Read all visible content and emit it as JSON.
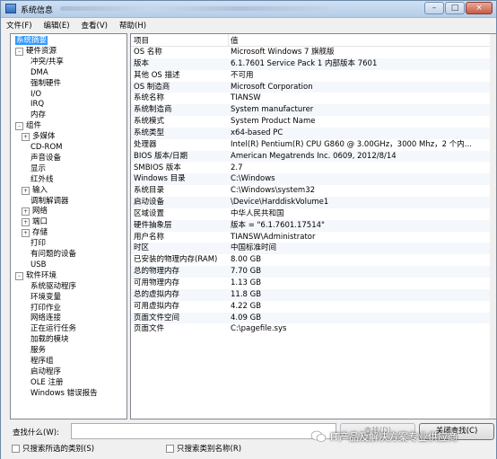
{
  "window": {
    "title": "系统信息",
    "path_hint": "",
    "buttons": {
      "minimize": "–",
      "maximize": "□",
      "close": "×"
    }
  },
  "menu": [
    "文件(F)",
    "编辑(E)",
    "查看(V)",
    "帮助(H)"
  ],
  "tree": [
    {
      "label": "系统摘要",
      "level": 0,
      "toggle": "",
      "selected": true
    },
    {
      "label": "硬件资源",
      "level": 0,
      "toggle": "–"
    },
    {
      "label": "冲突/共享",
      "level": 2,
      "toggle": ""
    },
    {
      "label": "DMA",
      "level": 2,
      "toggle": ""
    },
    {
      "label": "强制硬件",
      "level": 2,
      "toggle": ""
    },
    {
      "label": "I/O",
      "level": 2,
      "toggle": ""
    },
    {
      "label": "IRQ",
      "level": 2,
      "toggle": ""
    },
    {
      "label": "内存",
      "level": 2,
      "toggle": ""
    },
    {
      "label": "组件",
      "level": 0,
      "toggle": "–"
    },
    {
      "label": "多媒体",
      "level": 1,
      "toggle": "+"
    },
    {
      "label": "CD-ROM",
      "level": 2,
      "toggle": ""
    },
    {
      "label": "声音设备",
      "level": 2,
      "toggle": ""
    },
    {
      "label": "显示",
      "level": 2,
      "toggle": ""
    },
    {
      "label": "红外线",
      "level": 2,
      "toggle": ""
    },
    {
      "label": "输入",
      "level": 1,
      "toggle": "+"
    },
    {
      "label": "调制解调器",
      "level": 2,
      "toggle": ""
    },
    {
      "label": "网络",
      "level": 1,
      "toggle": "+"
    },
    {
      "label": "端口",
      "level": 1,
      "toggle": "+"
    },
    {
      "label": "存储",
      "level": 1,
      "toggle": "+"
    },
    {
      "label": "打印",
      "level": 2,
      "toggle": ""
    },
    {
      "label": "有问题的设备",
      "level": 2,
      "toggle": ""
    },
    {
      "label": "USB",
      "level": 2,
      "toggle": ""
    },
    {
      "label": "软件环境",
      "level": 0,
      "toggle": "–"
    },
    {
      "label": "系统驱动程序",
      "level": 2,
      "toggle": ""
    },
    {
      "label": "环境变量",
      "level": 2,
      "toggle": ""
    },
    {
      "label": "打印作业",
      "level": 2,
      "toggle": ""
    },
    {
      "label": "网络连接",
      "level": 2,
      "toggle": ""
    },
    {
      "label": "正在运行任务",
      "level": 2,
      "toggle": ""
    },
    {
      "label": "加载的模块",
      "level": 2,
      "toggle": ""
    },
    {
      "label": "服务",
      "level": 2,
      "toggle": ""
    },
    {
      "label": "程序组",
      "level": 2,
      "toggle": ""
    },
    {
      "label": "启动程序",
      "level": 2,
      "toggle": ""
    },
    {
      "label": "OLE 注册",
      "level": 2,
      "toggle": ""
    },
    {
      "label": "Windows 错误报告",
      "level": 2,
      "toggle": ""
    }
  ],
  "table": {
    "headers": {
      "item": "项目",
      "value": "值"
    },
    "rows": [
      {
        "item": "OS 名称",
        "value": "Microsoft Windows 7 旗舰版"
      },
      {
        "item": "版本",
        "value": "6.1.7601 Service Pack 1 内部版本 7601"
      },
      {
        "item": "其他 OS 描述",
        "value": "不可用"
      },
      {
        "item": "OS 制造商",
        "value": "Microsoft Corporation"
      },
      {
        "item": "系统名称",
        "value": "TIANSW"
      },
      {
        "item": "系统制造商",
        "value": "System manufacturer"
      },
      {
        "item": "系统模式",
        "value": "System Product Name"
      },
      {
        "item": "系统类型",
        "value": "x64-based PC"
      },
      {
        "item": "处理器",
        "value": "Intel(R) Pentium(R) CPU G860 @ 3.00GHz，3000 Mhz，2 个内..."
      },
      {
        "item": "BIOS 版本/日期",
        "value": "American Megatrends Inc. 0609, 2012/8/14"
      },
      {
        "item": "SMBIOS 版本",
        "value": "2.7"
      },
      {
        "item": "Windows 目录",
        "value": "C:\\Windows"
      },
      {
        "item": "系统目录",
        "value": "C:\\Windows\\system32"
      },
      {
        "item": "启动设备",
        "value": "\\Device\\HarddiskVolume1"
      },
      {
        "item": "区域设置",
        "value": "中华人民共和国"
      },
      {
        "item": "硬件抽象层",
        "value": "版本 = \"6.1.7601.17514\""
      },
      {
        "item": "用户名称",
        "value": "TIANSW\\Administrator"
      },
      {
        "item": "时区",
        "value": "中国标准时间"
      },
      {
        "item": "已安装的物理内存(RAM)",
        "value": "8.00 GB"
      },
      {
        "item": "总的物理内存",
        "value": "7.70 GB"
      },
      {
        "item": "可用物理内存",
        "value": "1.13 GB"
      },
      {
        "item": "总的虚拟内存",
        "value": "11.8 GB"
      },
      {
        "item": "可用虚拟内存",
        "value": "4.22 GB"
      },
      {
        "item": "页面文件空间",
        "value": "4.09 GB"
      },
      {
        "item": "页面文件",
        "value": "C:\\pagefile.sys"
      }
    ]
  },
  "find": {
    "label": "查找什么(W):",
    "value": "",
    "find_button": "查找(D)",
    "close_find_button": "关闭查找(C)",
    "option1": "只搜索所选的类别(S)",
    "option2": "只搜索类别名称(R)"
  },
  "watermark": "IT产品及解决方案专业供应商"
}
